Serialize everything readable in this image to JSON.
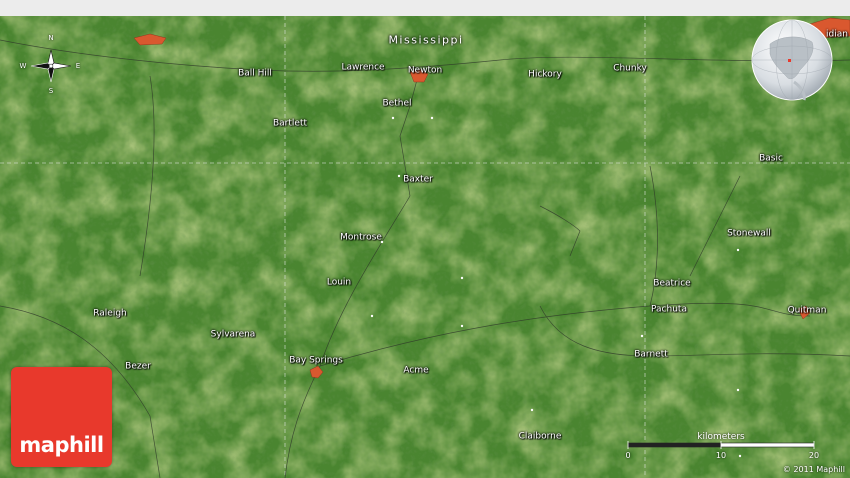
{
  "map": {
    "state_label": "Mississippi",
    "places": [
      {
        "name": "Ball Hill"
      },
      {
        "name": "Lawrence"
      },
      {
        "name": "Newton"
      },
      {
        "name": "Hickory"
      },
      {
        "name": "Chunky"
      },
      {
        "name": "Bethel"
      },
      {
        "name": "Bartlett"
      },
      {
        "name": "Basic"
      },
      {
        "name": "Baxter"
      },
      {
        "name": "Stonewall"
      },
      {
        "name": "Montrose"
      },
      {
        "name": "Louin"
      },
      {
        "name": "Beatrice"
      },
      {
        "name": "Pachuta"
      },
      {
        "name": "Quitman"
      },
      {
        "name": "Raleigh"
      },
      {
        "name": "Sylvarena"
      },
      {
        "name": "Bay Springs"
      },
      {
        "name": "Acme"
      },
      {
        "name": "Barnett"
      },
      {
        "name": "Bezer"
      },
      {
        "name": "Claiborne"
      },
      {
        "name": "idian"
      }
    ]
  },
  "compass": {
    "n": "N",
    "s": "S",
    "e": "E",
    "w": "W"
  },
  "scale": {
    "title": "kilometers",
    "ticks": [
      "0",
      "10",
      "20"
    ]
  },
  "logo": {
    "text": "maphill"
  },
  "copyright": "© 2011 Maphill",
  "colors": {
    "terrain": "#4f8a2f",
    "terrain_dark": "#3c6f26",
    "terrain_light": "#8aa845",
    "town": "#d9582f",
    "logo": "#e8392c"
  }
}
